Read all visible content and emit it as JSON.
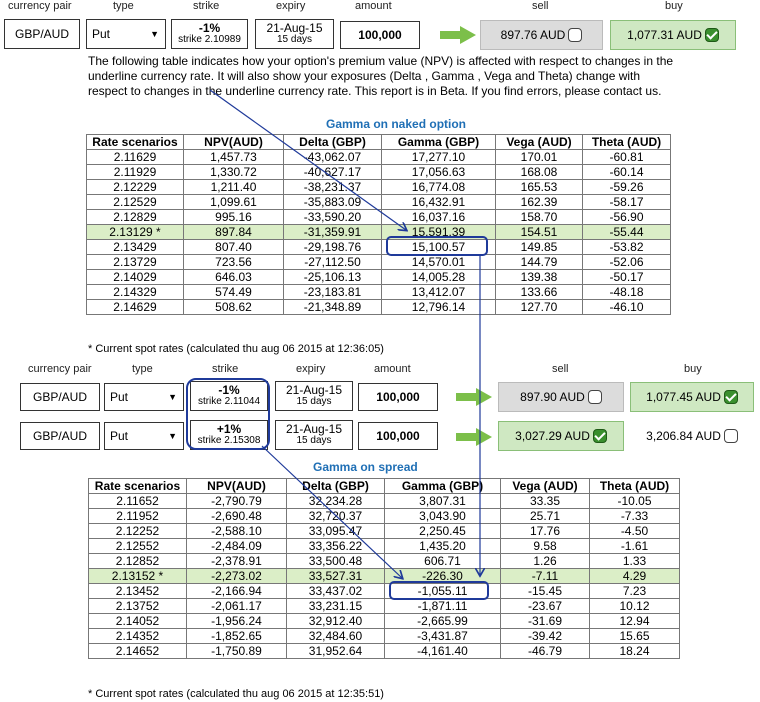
{
  "labels": {
    "currency_pair": "currency pair",
    "type": "type",
    "strike": "strike",
    "expiry": "expiry",
    "amount": "amount",
    "sell": "sell",
    "buy": "buy"
  },
  "top_row": {
    "pair": "GBP/AUD",
    "type": "Put",
    "strike_pct": "-1%",
    "strike_sub": "strike 2.10989",
    "expiry_date": "21-Aug-15",
    "expiry_days": "15 days",
    "amount": "100,000",
    "sell": "897.76 AUD",
    "buy": "1,077.31 AUD"
  },
  "description": "The following table indicates how your option's premium value (NPV) is affected with respect to changes in the underline currency rate. It will also show your exposures (Delta , Gamma , Vega and Theta) change with respect to changes in the underline currency rate. This report is in Beta. If you find errors, please contact us.",
  "table1": {
    "title": "Gamma on naked option",
    "headers": [
      "Rate scenarios",
      "NPV(AUD)",
      "Delta (GBP)",
      "Gamma (GBP)",
      "Vega (AUD)",
      "Theta (AUD)"
    ],
    "rows": [
      [
        "2.11629",
        "1,457.73",
        "-43,062.07",
        "17,277.10",
        "170.01",
        "-60.81"
      ],
      [
        "2.11929",
        "1,330.72",
        "-40,627.17",
        "17,056.63",
        "168.08",
        "-60.14"
      ],
      [
        "2.12229",
        "1,211.40",
        "-38,231.37",
        "16,774.08",
        "165.53",
        "-59.26"
      ],
      [
        "2.12529",
        "1,099.61",
        "-35,883.09",
        "16,432.91",
        "162.39",
        "-58.17"
      ],
      [
        "2.12829",
        "995.16",
        "-33,590.20",
        "16,037.16",
        "158.70",
        "-56.90"
      ],
      [
        "2.13129 *",
        "897.84",
        "-31,359.91",
        "15,591.39",
        "154.51",
        "-55.44"
      ],
      [
        "2.13429",
        "807.40",
        "-29,198.76",
        "15,100.57",
        "149.85",
        "-53.82"
      ],
      [
        "2.13729",
        "723.56",
        "-27,112.50",
        "14,570.01",
        "144.79",
        "-52.06"
      ],
      [
        "2.14029",
        "646.03",
        "-25,106.13",
        "14,005.28",
        "139.38",
        "-50.17"
      ],
      [
        "2.14329",
        "574.49",
        "-23,183.81",
        "13,412.07",
        "133.66",
        "-48.18"
      ],
      [
        "2.14629",
        "508.62",
        "-21,348.89",
        "12,796.14",
        "127.70",
        "-46.10"
      ]
    ],
    "highlight_row": 5,
    "note": "* Current spot rates (calculated thu aug 06 2015 at 12:36:05)"
  },
  "spread_rows": [
    {
      "pair": "GBP/AUD",
      "type": "Put",
      "strike_pct": "-1%",
      "strike_sub": "strike 2.11044",
      "expiry_date": "21-Aug-15",
      "expiry_days": "15 days",
      "amount": "100,000",
      "sell": "897.90 AUD",
      "buy": "1,077.45 AUD",
      "checked": "buy"
    },
    {
      "pair": "GBP/AUD",
      "type": "Put",
      "strike_pct": "+1%",
      "strike_sub": "strike 2.15308",
      "expiry_date": "21-Aug-15",
      "expiry_days": "15 days",
      "amount": "100,000",
      "sell": "3,027.29 AUD",
      "buy": "3,206.84 AUD",
      "checked": "sell"
    }
  ],
  "table2": {
    "title": "Gamma on spread",
    "headers": [
      "Rate scenarios",
      "NPV(AUD)",
      "Delta (GBP)",
      "Gamma (GBP)",
      "Vega (AUD)",
      "Theta (AUD)"
    ],
    "rows": [
      [
        "2.11652",
        "-2,790.79",
        "32,234.28",
        "3,807.31",
        "33.35",
        "-10.05"
      ],
      [
        "2.11952",
        "-2,690.48",
        "32,720.37",
        "3,043.90",
        "25.71",
        "-7.33"
      ],
      [
        "2.12252",
        "-2,588.10",
        "33,095.47",
        "2,250.45",
        "17.76",
        "-4.50"
      ],
      [
        "2.12552",
        "-2,484.09",
        "33,356.22",
        "1,435.20",
        "9.58",
        "-1.61"
      ],
      [
        "2.12852",
        "-2,378.91",
        "33,500.48",
        "606.71",
        "1.26",
        "1.33"
      ],
      [
        "2.13152 *",
        "-2,273.02",
        "33,527.31",
        "-226.30",
        "-7.11",
        "4.29"
      ],
      [
        "2.13452",
        "-2,166.94",
        "33,437.02",
        "-1,055.11",
        "-15.45",
        "7.23"
      ],
      [
        "2.13752",
        "-2,061.17",
        "33,231.15",
        "-1,871.11",
        "-23.67",
        "10.12"
      ],
      [
        "2.14052",
        "-1,956.24",
        "32,912.40",
        "-2,665.99",
        "-31.69",
        "12.94"
      ],
      [
        "2.14352",
        "-1,852.65",
        "32,484.60",
        "-3,431.87",
        "-39.42",
        "15.65"
      ],
      [
        "2.14652",
        "-1,750.89",
        "31,952.64",
        "-4,161.40",
        "-46.79",
        "18.24"
      ]
    ],
    "highlight_row": 5,
    "note": "* Current spot rates (calculated thu aug 06 2015 at 12:35:51)"
  },
  "colors": {
    "accent_green": "#7cbf4a",
    "highlight_row": "#dbeec7",
    "annotation_blue": "#1f3a9a",
    "title_blue": "#1f6fb5"
  },
  "icons": {
    "arrow": "green-right-arrow-icon",
    "checkbox": "checkbox-icon",
    "dropdown": "chevron-down-icon"
  }
}
